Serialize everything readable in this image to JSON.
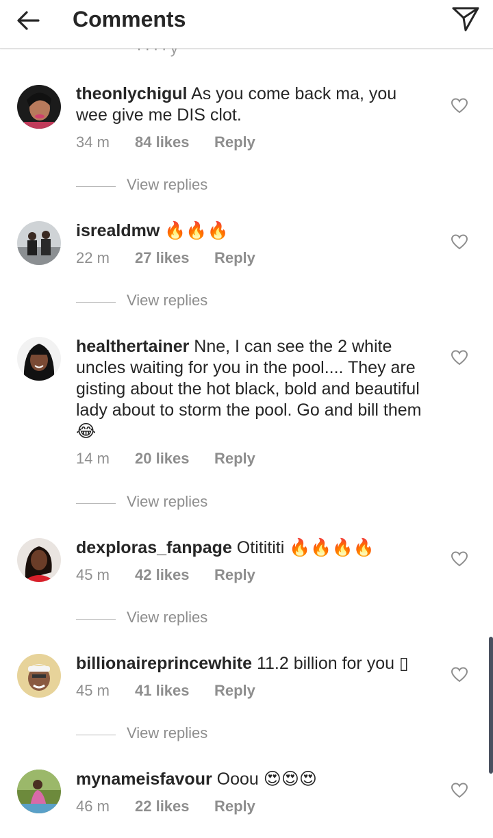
{
  "header": {
    "title": "Comments",
    "back_icon": "arrow-left-icon",
    "send_icon": "paper-plane-icon"
  },
  "peek_text": "∙  ∙  ∙  ∙ y",
  "comments": [
    {
      "username": "theonlychigul",
      "text": " As you come back ma, you wee give me DIS clot.",
      "time": "34 m",
      "likes": "84 likes",
      "reply": "Reply",
      "view_replies": "View replies"
    },
    {
      "username": "isrealdmw",
      "text": " 🔥🔥🔥",
      "time": "22 m",
      "likes": "27 likes",
      "reply": "Reply",
      "view_replies": "View replies"
    },
    {
      "username": "healthertainer",
      "text": " Nne, I can see the 2 white uncles waiting for you in the pool.... They are gisting about the hot black, bold and beautiful lady about to storm the pool. Go and bill them 😂",
      "time": "14 m",
      "likes": "20 likes",
      "reply": "Reply",
      "view_replies": "View replies"
    },
    {
      "username": "dexploras_fanpage",
      "text": " Otitititi 🔥🔥🔥🔥",
      "time": "45 m",
      "likes": "42 likes",
      "reply": "Reply",
      "view_replies": "View replies"
    },
    {
      "username": "billionaireprincewhite",
      "text": " 11.2 billion for you ▯",
      "time": "45 m",
      "likes": "41 likes",
      "reply": "Reply",
      "view_replies": "View replies"
    },
    {
      "username": "mynameisfavour",
      "text": " Ooou 😍😍😍",
      "time": "46 m",
      "likes": "22 likes",
      "reply": "Reply"
    }
  ]
}
